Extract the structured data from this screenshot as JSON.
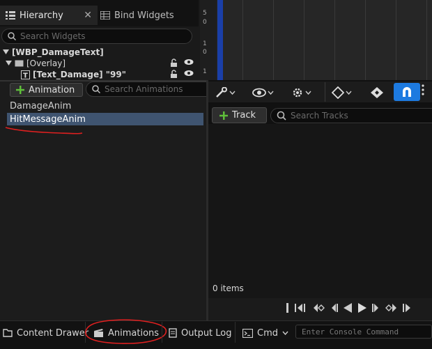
{
  "hierarchy": {
    "tabs": [
      {
        "label": "Hierarchy",
        "icon": "list-icon",
        "close": "✕"
      },
      {
        "label": "Bind Widgets",
        "icon": "grid-icon"
      }
    ],
    "search_placeholder": "Search Widgets",
    "tree": [
      {
        "label": "[WBP_DamageText]",
        "icon": "caret-down-icon"
      },
      {
        "label": "[Overlay]",
        "icon": "overlay-icon"
      },
      {
        "label": "[Text_Damage] \"99\"",
        "icon": "text-icon"
      }
    ]
  },
  "ruler": {
    "labels": [
      "5",
      "0",
      "1",
      "0",
      "1"
    ]
  },
  "animations": {
    "add_label": "Animation",
    "search_placeholder": "Search Animations",
    "items": [
      "DamageAnim",
      "HitMessageAnim"
    ],
    "selected_index": 1
  },
  "sequencer": {
    "toolbar_icons": [
      "wrench-icon",
      "eye-icon",
      "gear-icon",
      "diamond-icon",
      "key-icon",
      "magnet-icon",
      "more-icon"
    ],
    "add_track_label": "Track",
    "search_placeholder": "Search Tracks",
    "items_count": "0 items"
  },
  "bottom_bar": {
    "content_drawer": "Content Drawer",
    "animations": "Animations",
    "output_log": "Output Log",
    "cmd": "Cmd",
    "console_placeholder": "Enter Console Command"
  },
  "colors": {
    "selection": "#3f5470",
    "accent_blue": "#1d7ae0",
    "annotation_red": "#e02020",
    "add_green": "#5fbf3a"
  }
}
